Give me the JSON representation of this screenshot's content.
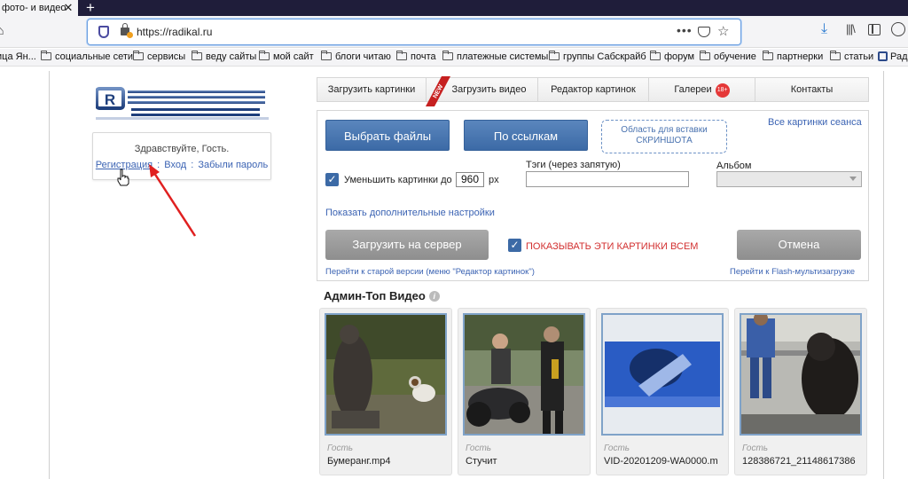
{
  "browser": {
    "tab_title": "фото- и видео",
    "tab_close": "✕",
    "new_tab": "+",
    "url": "https://radikal.ru",
    "more": "•••"
  },
  "bookmarks": [
    "ица Ян...",
    "социальные сети",
    "сервисы",
    "веду сайты",
    "мой сайт",
    "блоги читаю",
    "почта",
    "платежные системы",
    "группы Сабскрайб",
    "форум",
    "обучение",
    "партнерки",
    "статьи",
    "Рад"
  ],
  "auth": {
    "greeting": "Здравствуйте, Гость.",
    "register": "Регистрация",
    "login": "Вход",
    "forgot": "Забыли пароль",
    "separator": ":"
  },
  "menu": {
    "upload_images": "Загрузить картинки",
    "upload_video": "Загрузить видео",
    "editor": "Редактор картинок",
    "galleries": "Галереи",
    "age_badge": "18+",
    "contacts": "Контакты"
  },
  "upload": {
    "choose_files": "Выбрать файлы",
    "by_links": "По ссылкам",
    "paste_area_line1": "Область для вставки",
    "paste_area_line2": "СКРИНШОТА",
    "session_images": "Все картинки сеанса",
    "resize_label": "Уменьшить картинки до",
    "resize_value": "960",
    "resize_unit": "px",
    "tags_label": "Тэги (через запятую)",
    "album_label": "Альбом",
    "more_settings": "Показать дополнительные настройки",
    "upload_to_server": "Загрузить на сервер",
    "show_all": "ПОКАЗЫВАТЬ ЭТИ КАРТИНКИ ВСЕМ",
    "cancel": "Отмена",
    "old_version": "Перейти к старой версии (меню \"Редактор картинок\")",
    "flash_upload": "Перейти к Flash-мультизагрузке",
    "checkmark": "✓"
  },
  "gallery": {
    "title": "Админ-Топ Видео",
    "info": "i",
    "videos": [
      {
        "author": "Гость",
        "name": "Бумеранг.mp4"
      },
      {
        "author": "Гость",
        "name": "Стучит"
      },
      {
        "author": "Гость",
        "name": "VID-20201209-WA0000.m"
      },
      {
        "author": "Гость",
        "name": "128386721_21148617386"
      }
    ]
  }
}
